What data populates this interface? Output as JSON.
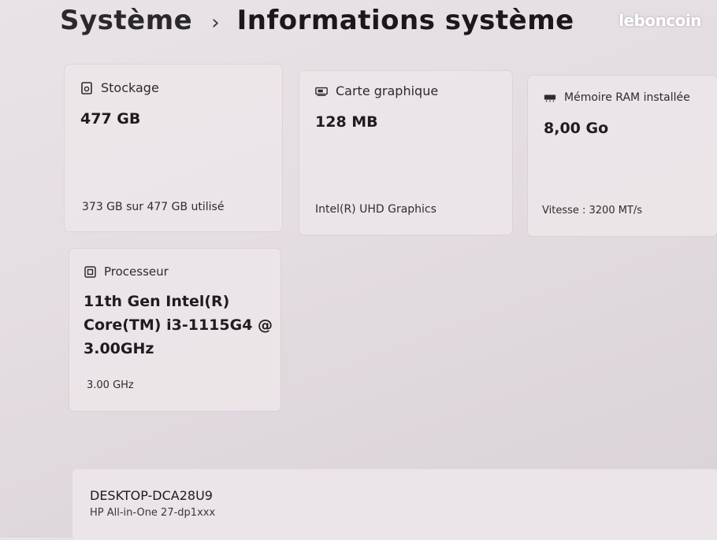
{
  "breadcrumb": {
    "parent": "Système",
    "separator": "›",
    "current": "Informations système"
  },
  "watermark": {
    "text": "leboncoin"
  },
  "cards": {
    "storage": {
      "icon": "storage-icon",
      "title": "Stockage",
      "value": "477 GB",
      "detail": "373 GB sur 477 GB utilisé"
    },
    "gpu": {
      "icon": "display-adapter-icon",
      "title": "Carte graphique",
      "value": "128 MB",
      "detail": "Intel(R) UHD Graphics"
    },
    "ram": {
      "icon": "memory-icon",
      "title": "Mémoire RAM installée",
      "value": "8,00 Go",
      "detail": "Vitesse : 3200 MT/s"
    },
    "cpu": {
      "icon": "processor-icon",
      "title": "Processeur",
      "value_lines": [
        "11th Gen Intel(R)",
        "Core(TM) i3-1115G4 @",
        "3.00GHz"
      ],
      "detail": "3.00 GHz"
    }
  },
  "device": {
    "name": "DESKTOP-DCA28U9",
    "model": "HP All-in-One 27-dp1xxx"
  }
}
